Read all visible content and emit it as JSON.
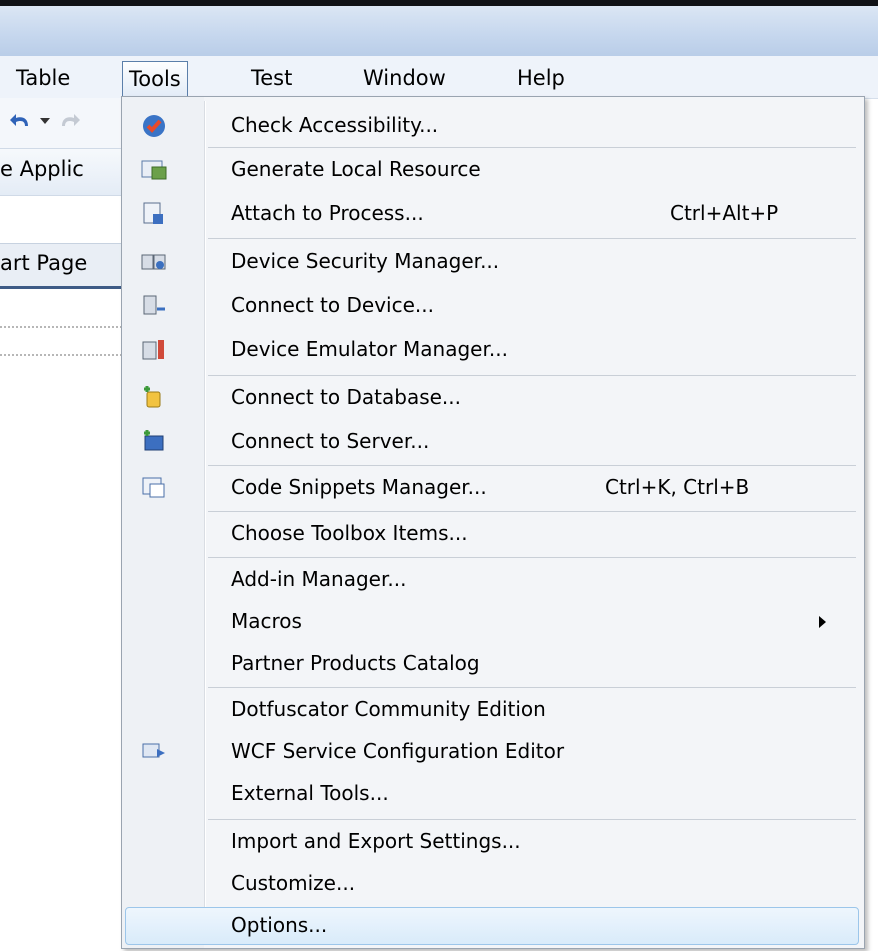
{
  "menubar": {
    "items": [
      {
        "label": "Table"
      },
      {
        "label": "Tools"
      },
      {
        "label": "Test"
      },
      {
        "label": "Window"
      },
      {
        "label": "Help"
      }
    ]
  },
  "left_pane": {
    "panel_label": "e Applic",
    "tab_label": "art Page"
  },
  "tools_menu": {
    "items": [
      {
        "label": "Check Accessibility...",
        "icon": "accessibility-check-icon"
      },
      {
        "label": "Generate Local Resource",
        "icon": "local-resource-icon"
      },
      {
        "label": "Attach to Process...",
        "shortcut": "Ctrl+Alt+P",
        "icon": "attach-process-icon"
      },
      {
        "label": "Device Security Manager...",
        "icon": "device-security-icon"
      },
      {
        "label": "Connect to Device...",
        "icon": "connect-device-icon"
      },
      {
        "label": "Device Emulator Manager...",
        "icon": "device-emulator-icon"
      },
      {
        "label": "Connect to Database...",
        "icon": "connect-database-icon"
      },
      {
        "label": "Connect to Server...",
        "icon": "connect-server-icon"
      },
      {
        "label": "Code Snippets Manager...",
        "shortcut": "Ctrl+K, Ctrl+B",
        "icon": "code-snippets-icon"
      },
      {
        "label": "Choose Toolbox Items..."
      },
      {
        "label": "Add-in Manager..."
      },
      {
        "label": "Macros",
        "submenu": true
      },
      {
        "label": "Partner Products Catalog"
      },
      {
        "label": "Dotfuscator Community Edition"
      },
      {
        "label": "WCF Service Configuration Editor",
        "icon": "wcf-config-icon"
      },
      {
        "label": "External Tools..."
      },
      {
        "label": "Import and Export Settings..."
      },
      {
        "label": "Customize..."
      },
      {
        "label": "Options...",
        "highlighted": true
      }
    ]
  },
  "colors": {
    "title_gradient": "#c7d8ee",
    "menu_background": "#f3f5f8",
    "highlight": "#d9ebfa",
    "highlight_border": "#9cc6ea"
  }
}
